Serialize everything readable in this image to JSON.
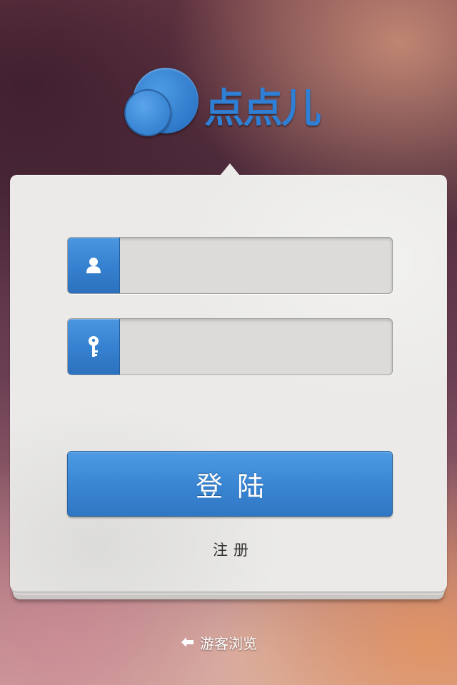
{
  "app": {
    "logo_text": "点点儿"
  },
  "login_form": {
    "username_field": {
      "icon": "user-icon",
      "value": "",
      "placeholder": ""
    },
    "password_field": {
      "icon": "key-icon",
      "value": "",
      "placeholder": ""
    },
    "login_button_label": "登陆",
    "register_link_label": "注册"
  },
  "footer": {
    "guest_icon": "arrow-left-icon",
    "guest_label": "游客浏览"
  },
  "colors": {
    "accent": "#3a86d4",
    "card_background": "#ebeae8",
    "text_dark": "#333333"
  }
}
